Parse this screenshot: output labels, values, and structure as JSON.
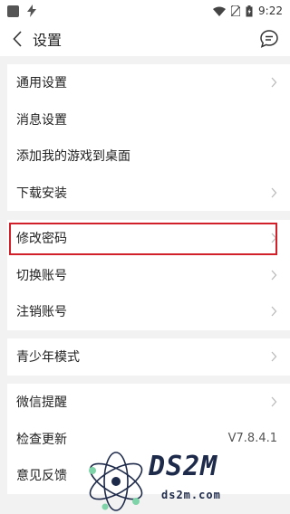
{
  "status_bar": {
    "time": "9:22"
  },
  "header": {
    "title": "设置"
  },
  "groups": [
    {
      "items": [
        {
          "label": "通用设置",
          "chevron": true
        },
        {
          "label": "消息设置",
          "chevron": false
        },
        {
          "label": "添加我的游戏到桌面",
          "chevron": false
        },
        {
          "label": "下载安装",
          "chevron": true
        }
      ]
    },
    {
      "items": [
        {
          "label": "修改密码",
          "chevron": true
        },
        {
          "label": "切换账号",
          "chevron": true
        },
        {
          "label": "注销账号",
          "chevron": true
        }
      ]
    },
    {
      "items": [
        {
          "label": "青少年模式",
          "chevron": true
        }
      ]
    },
    {
      "items": [
        {
          "label": "微信提醒",
          "chevron": true
        },
        {
          "label": "检查更新",
          "value": "V7.8.4.1"
        },
        {
          "label": "意见反馈",
          "chevron": false
        }
      ]
    }
  ],
  "watermark": {
    "brand": "DS2M",
    "url": "ds2m.com"
  },
  "colors": {
    "highlight": "#d1202a",
    "background": "#f2f2f2",
    "card": "#ffffff"
  }
}
